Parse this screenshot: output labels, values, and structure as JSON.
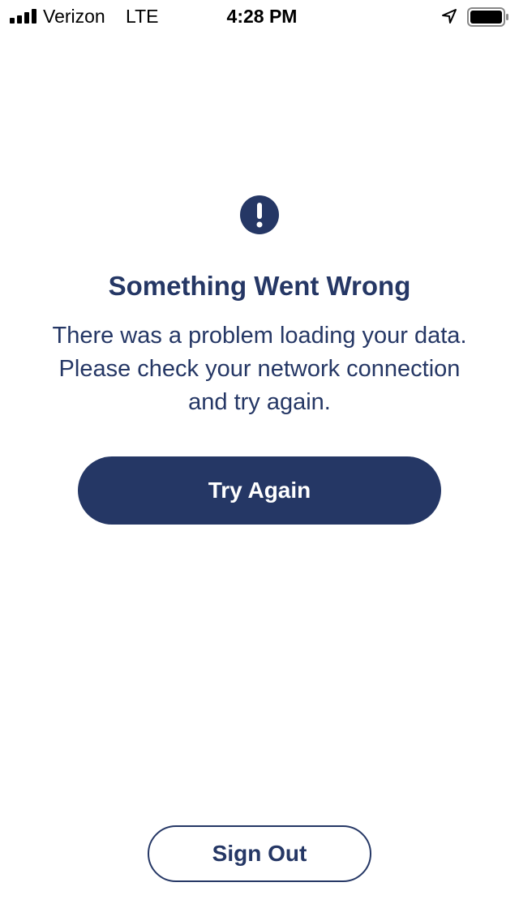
{
  "status_bar": {
    "carrier": "Verizon",
    "network": "LTE",
    "time": "4:28 PM",
    "icons": [
      "signal-bars-icon",
      "location-arrow-icon",
      "battery-icon"
    ]
  },
  "error": {
    "icon": "exclamation-circle-icon",
    "title": "Something Went Wrong",
    "message": "There was a problem loading your data. Please check your network connection and try again."
  },
  "actions": {
    "try_again_label": "Try Again",
    "sign_out_label": "Sign Out"
  },
  "colors": {
    "primary": "#253765",
    "background": "#ffffff"
  }
}
